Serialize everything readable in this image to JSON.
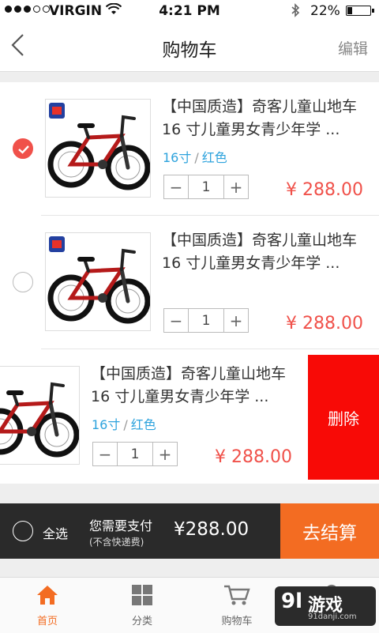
{
  "status": {
    "carrier": "VIRGIN",
    "time": "4:21 PM",
    "battery": "22%"
  },
  "nav": {
    "title": "购物车",
    "edit": "编辑"
  },
  "items": [
    {
      "title_line1": "【中国质造】奇客儿童山地车",
      "title_line2": "16 寸儿童男女青少年学 ...",
      "spec_size": "16寸",
      "spec_sep": "/",
      "spec_color": "红色",
      "qty": "1",
      "price": "¥ 288.00",
      "checked": true
    },
    {
      "title_line1": "【中国质造】奇客儿童山地车",
      "title_line2": "16 寸儿童男女青少年学 ...",
      "qty": "1",
      "price": "¥ 288.00",
      "checked": false
    },
    {
      "title_line1": "【中国质造】奇客儿童山地车",
      "title_line2": "16 寸儿童男女青少年学 ...",
      "spec_size": "16寸",
      "spec_sep": "/",
      "spec_color": "红色",
      "qty": "1",
      "price": "¥ 288.00",
      "delete_label": "删除"
    }
  ],
  "checkout": {
    "select_all": "全选",
    "need_pay": "您需要支付",
    "shipping_note": "(不含快递费)",
    "total": "¥288.00",
    "go_checkout": "去结算"
  },
  "tabs": [
    {
      "label": "首页",
      "icon": "home-icon",
      "active": true
    },
    {
      "label": "分类",
      "icon": "grid-icon"
    },
    {
      "label": "购物车",
      "icon": "cart-icon"
    }
  ],
  "watermark": {
    "logo": "9l",
    "text": "游戏",
    "url": "91danji.com"
  },
  "colors": {
    "accent_red": "#f0514a",
    "delete_red": "#f80a06",
    "checkout_orange": "#f36c22",
    "spec_blue": "#2ea3dd",
    "bar_dark": "#2a2a2a"
  }
}
